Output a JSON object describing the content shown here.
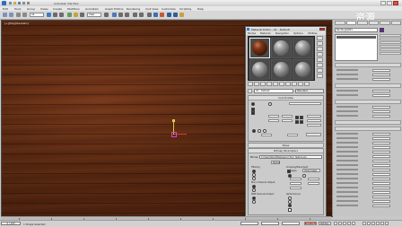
{
  "app": {
    "title": "Autodesk 3ds Max",
    "menus": [
      "Edit",
      "Tools",
      "Group",
      "Views",
      "Create",
      "Modifiers",
      "Animation",
      "Graph Editors",
      "Rendering",
      "Civil View",
      "Customize",
      "Scripting",
      "Help"
    ]
  },
  "toolbar": {
    "selection_set": "All",
    "view_combo": "View"
  },
  "viewport": {
    "label": "[+][Top][Realistic]"
  },
  "material_editor": {
    "title": "Material Editor - 01 - Default",
    "menus": [
      "Modes",
      "Material",
      "Navigation",
      "Options",
      "Utilities"
    ],
    "material_name": "01 - Default",
    "material_type": "Standard",
    "rollouts": {
      "coordinates": "Coordinates",
      "noise": "Noise",
      "bitmap_parameters": "Bitmap Parameters",
      "time": "Time"
    },
    "bitmap_label": "Bitmap:",
    "bitmap_path": "C:\\Users\\Wood\\Maps\\wood_floor_texture.jpg",
    "reload_label": "Reload",
    "filtering_label": "Filtering",
    "cropping_label": "Cropping/Placement",
    "apply_label": "Apply",
    "view_image_label": "View Image",
    "mono_output_label": "Mono Channel Output:",
    "rgb_output_label": "RGB Channel Output:",
    "alpha_source_label": "Alpha Source"
  },
  "command_panel": {
    "object_name": "Rectangle001",
    "modifier_list_label": "Modifier List"
  },
  "status": {
    "frame": "0 / 100",
    "selected": "1 Shape Selected",
    "auto_key": "Auto Key",
    "set_key": "Set Key"
  },
  "watermark": "资源"
}
